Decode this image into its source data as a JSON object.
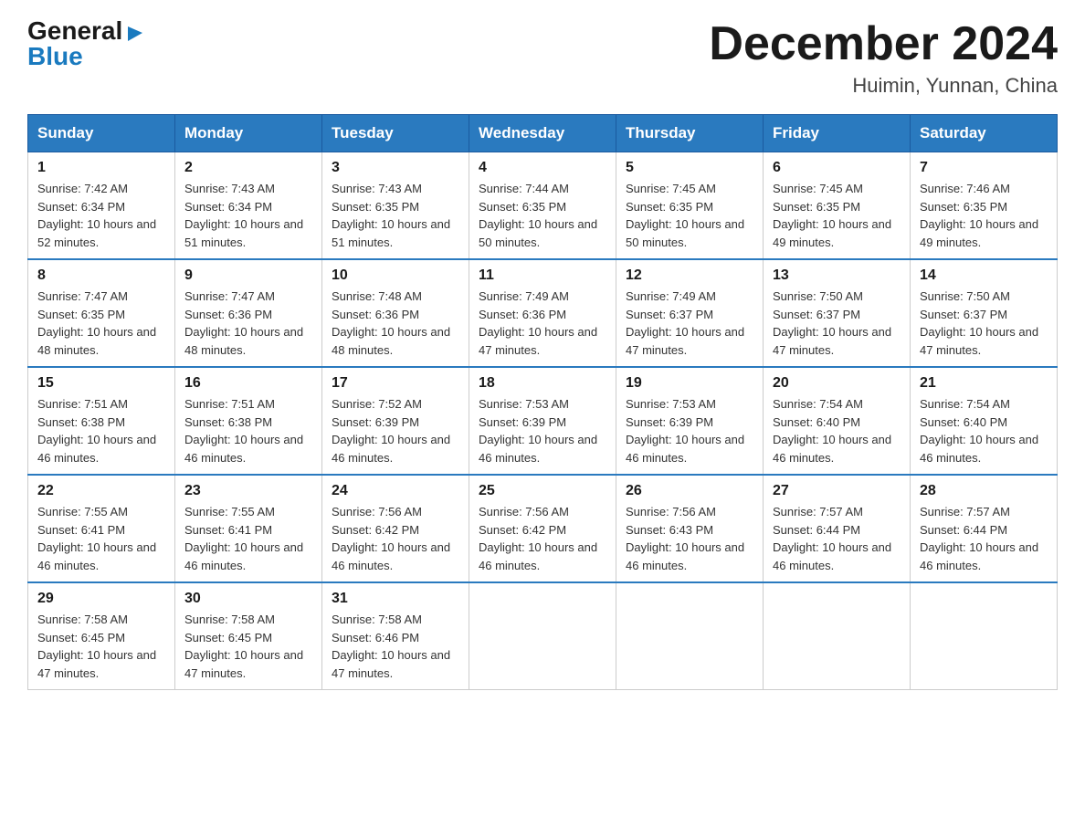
{
  "header": {
    "logo": {
      "general": "General",
      "triangle": "▶",
      "blue": "Blue"
    },
    "title": "December 2024",
    "location": "Huimin, Yunnan, China"
  },
  "weekdays": [
    "Sunday",
    "Monday",
    "Tuesday",
    "Wednesday",
    "Thursday",
    "Friday",
    "Saturday"
  ],
  "weeks": [
    [
      {
        "day": "1",
        "sunrise": "7:42 AM",
        "sunset": "6:34 PM",
        "daylight": "10 hours and 52 minutes."
      },
      {
        "day": "2",
        "sunrise": "7:43 AM",
        "sunset": "6:34 PM",
        "daylight": "10 hours and 51 minutes."
      },
      {
        "day": "3",
        "sunrise": "7:43 AM",
        "sunset": "6:35 PM",
        "daylight": "10 hours and 51 minutes."
      },
      {
        "day": "4",
        "sunrise": "7:44 AM",
        "sunset": "6:35 PM",
        "daylight": "10 hours and 50 minutes."
      },
      {
        "day": "5",
        "sunrise": "7:45 AM",
        "sunset": "6:35 PM",
        "daylight": "10 hours and 50 minutes."
      },
      {
        "day": "6",
        "sunrise": "7:45 AM",
        "sunset": "6:35 PM",
        "daylight": "10 hours and 49 minutes."
      },
      {
        "day": "7",
        "sunrise": "7:46 AM",
        "sunset": "6:35 PM",
        "daylight": "10 hours and 49 minutes."
      }
    ],
    [
      {
        "day": "8",
        "sunrise": "7:47 AM",
        "sunset": "6:35 PM",
        "daylight": "10 hours and 48 minutes."
      },
      {
        "day": "9",
        "sunrise": "7:47 AM",
        "sunset": "6:36 PM",
        "daylight": "10 hours and 48 minutes."
      },
      {
        "day": "10",
        "sunrise": "7:48 AM",
        "sunset": "6:36 PM",
        "daylight": "10 hours and 48 minutes."
      },
      {
        "day": "11",
        "sunrise": "7:49 AM",
        "sunset": "6:36 PM",
        "daylight": "10 hours and 47 minutes."
      },
      {
        "day": "12",
        "sunrise": "7:49 AM",
        "sunset": "6:37 PM",
        "daylight": "10 hours and 47 minutes."
      },
      {
        "day": "13",
        "sunrise": "7:50 AM",
        "sunset": "6:37 PM",
        "daylight": "10 hours and 47 minutes."
      },
      {
        "day": "14",
        "sunrise": "7:50 AM",
        "sunset": "6:37 PM",
        "daylight": "10 hours and 47 minutes."
      }
    ],
    [
      {
        "day": "15",
        "sunrise": "7:51 AM",
        "sunset": "6:38 PM",
        "daylight": "10 hours and 46 minutes."
      },
      {
        "day": "16",
        "sunrise": "7:51 AM",
        "sunset": "6:38 PM",
        "daylight": "10 hours and 46 minutes."
      },
      {
        "day": "17",
        "sunrise": "7:52 AM",
        "sunset": "6:39 PM",
        "daylight": "10 hours and 46 minutes."
      },
      {
        "day": "18",
        "sunrise": "7:53 AM",
        "sunset": "6:39 PM",
        "daylight": "10 hours and 46 minutes."
      },
      {
        "day": "19",
        "sunrise": "7:53 AM",
        "sunset": "6:39 PM",
        "daylight": "10 hours and 46 minutes."
      },
      {
        "day": "20",
        "sunrise": "7:54 AM",
        "sunset": "6:40 PM",
        "daylight": "10 hours and 46 minutes."
      },
      {
        "day": "21",
        "sunrise": "7:54 AM",
        "sunset": "6:40 PM",
        "daylight": "10 hours and 46 minutes."
      }
    ],
    [
      {
        "day": "22",
        "sunrise": "7:55 AM",
        "sunset": "6:41 PM",
        "daylight": "10 hours and 46 minutes."
      },
      {
        "day": "23",
        "sunrise": "7:55 AM",
        "sunset": "6:41 PM",
        "daylight": "10 hours and 46 minutes."
      },
      {
        "day": "24",
        "sunrise": "7:56 AM",
        "sunset": "6:42 PM",
        "daylight": "10 hours and 46 minutes."
      },
      {
        "day": "25",
        "sunrise": "7:56 AM",
        "sunset": "6:42 PM",
        "daylight": "10 hours and 46 minutes."
      },
      {
        "day": "26",
        "sunrise": "7:56 AM",
        "sunset": "6:43 PM",
        "daylight": "10 hours and 46 minutes."
      },
      {
        "day": "27",
        "sunrise": "7:57 AM",
        "sunset": "6:44 PM",
        "daylight": "10 hours and 46 minutes."
      },
      {
        "day": "28",
        "sunrise": "7:57 AM",
        "sunset": "6:44 PM",
        "daylight": "10 hours and 46 minutes."
      }
    ],
    [
      {
        "day": "29",
        "sunrise": "7:58 AM",
        "sunset": "6:45 PM",
        "daylight": "10 hours and 47 minutes."
      },
      {
        "day": "30",
        "sunrise": "7:58 AM",
        "sunset": "6:45 PM",
        "daylight": "10 hours and 47 minutes."
      },
      {
        "day": "31",
        "sunrise": "7:58 AM",
        "sunset": "6:46 PM",
        "daylight": "10 hours and 47 minutes."
      },
      null,
      null,
      null,
      null
    ]
  ]
}
